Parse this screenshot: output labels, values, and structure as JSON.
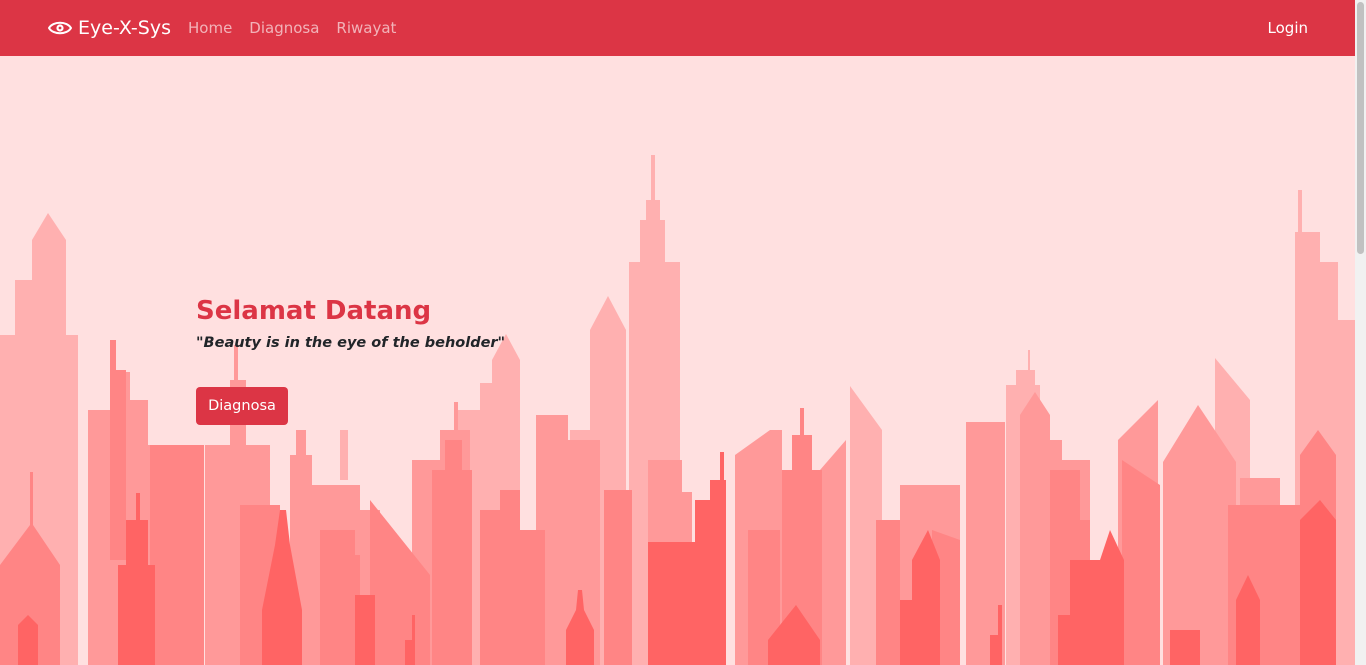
{
  "navbar": {
    "brand": "Eye-X-Sys",
    "brand_icon": "eye-icon",
    "links": [
      "Home",
      "Diagnosa",
      "Riwayat"
    ],
    "login": "Login",
    "color": "#dc3545"
  },
  "hero": {
    "title": "Selamat Datang",
    "quote": "\"Beauty is in the eye of the beholder\"",
    "button": "Diagnosa"
  },
  "colors": {
    "background": "#ffe0e0",
    "accent": "#dc3545",
    "skyline_light": "#ffb3b3",
    "skyline_mid": "#ff8f8f",
    "skyline_dark": "#ff5f5f"
  }
}
